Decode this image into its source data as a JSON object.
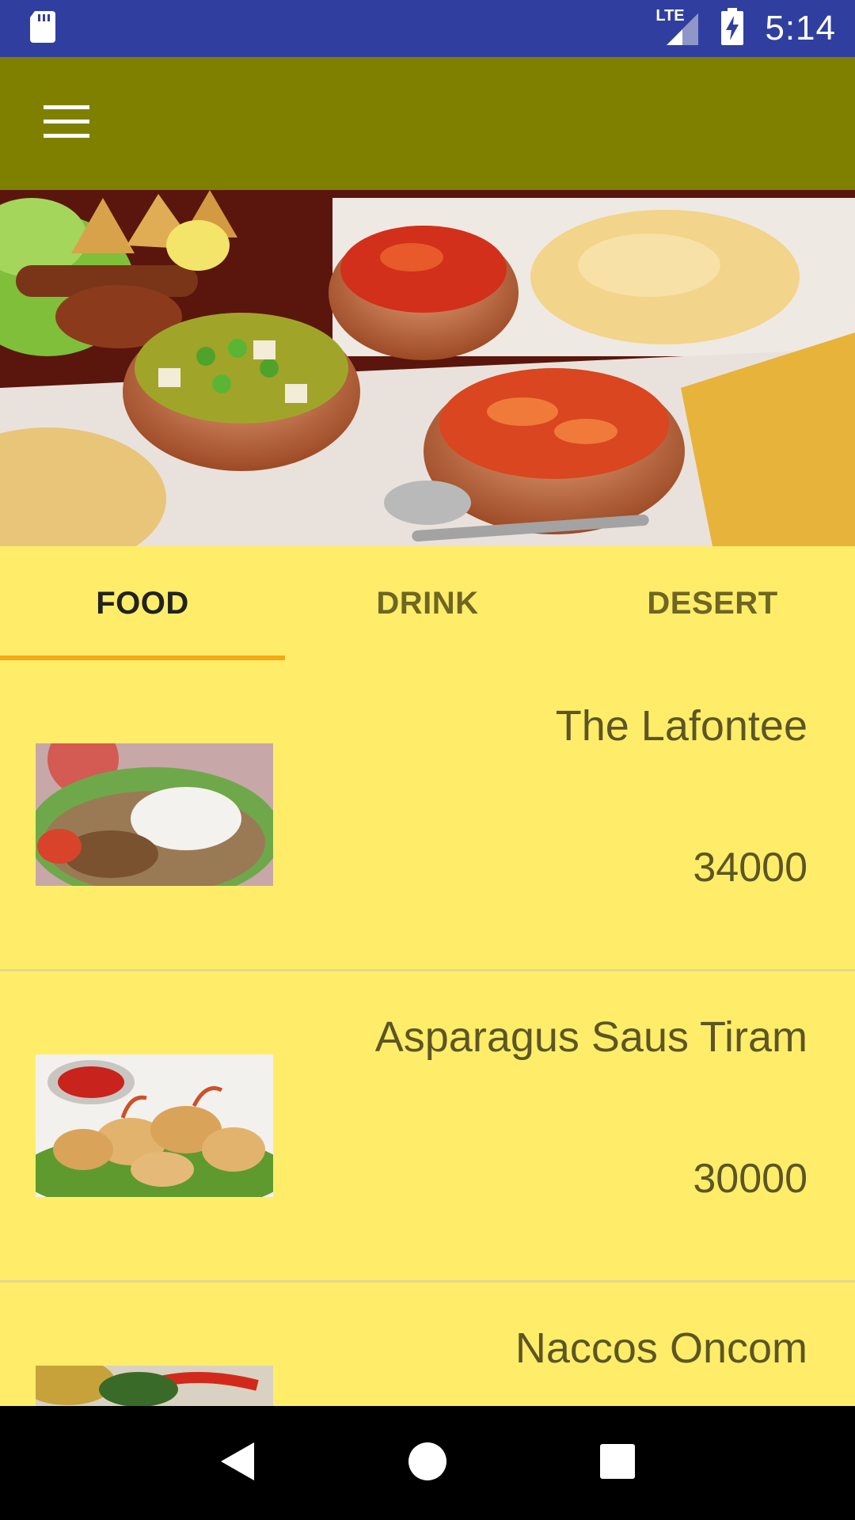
{
  "status_bar": {
    "time": "5:14",
    "network": "LTE",
    "icons": [
      "sd-card-icon",
      "lte-signal-icon",
      "battery-charging-icon"
    ]
  },
  "app_bar": {
    "menu_icon": "hamburger-menu-icon",
    "color": "#808000"
  },
  "hero": {
    "image": "indian-food-spread-banner"
  },
  "tabs": [
    {
      "label": "FOOD",
      "active": true
    },
    {
      "label": "DRINK",
      "active": false
    },
    {
      "label": "DESERT",
      "active": false
    }
  ],
  "items": [
    {
      "name": "The Lafontee",
      "price": "34000",
      "image": "noodle-soup-dish"
    },
    {
      "name": "Asparagus Saus Tiram",
      "price": "30000",
      "image": "fried-shrimp-dish"
    },
    {
      "name": "Naccos Oncom",
      "price": "",
      "image": "grilled-vegetable-dish"
    }
  ],
  "nav_bar": {
    "icons": [
      "back-icon",
      "home-icon",
      "recents-icon"
    ]
  },
  "colors": {
    "status_bar": "#303F9F",
    "app_bar": "#808000",
    "background": "#FFED6A",
    "tab_indicator": "#F4A916"
  }
}
